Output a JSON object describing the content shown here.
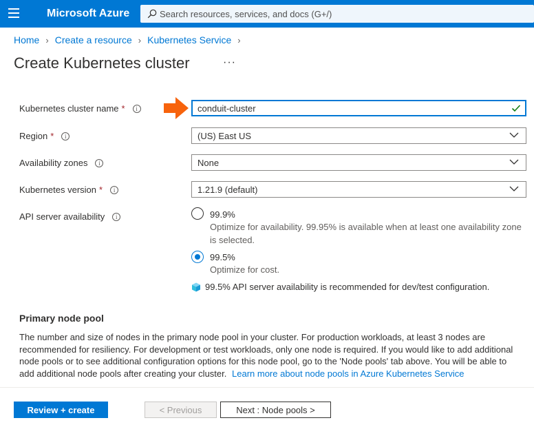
{
  "topbar": {
    "brand": "Microsoft Azure",
    "search_placeholder": "Search resources, services, and docs (G+/)"
  },
  "breadcrumb": [
    "Home",
    "Create a resource",
    "Kubernetes Service"
  ],
  "page_title": "Create Kubernetes cluster",
  "more_label": "···",
  "form": {
    "cluster_name": {
      "label": "Kubernetes cluster name",
      "required": "*",
      "value": "conduit-cluster"
    },
    "region": {
      "label": "Region",
      "required": "*",
      "value": "(US) East US"
    },
    "availability_zones": {
      "label": "Availability zones",
      "value": "None"
    },
    "kubernetes_version": {
      "label": "Kubernetes version",
      "required": "*",
      "value": "1.21.9 (default)"
    },
    "api_server": {
      "label": "API server availability",
      "options": [
        {
          "label": "99.9%",
          "description": "Optimize for availability. 99.95% is available when at least one availability zone is selected.",
          "selected": false
        },
        {
          "label": "99.5%",
          "description": "Optimize for cost.",
          "selected": true
        }
      ],
      "note": "99.5% API server availability is recommended for dev/test configuration."
    }
  },
  "node_pool": {
    "title": "Primary node pool",
    "text": "The number and size of nodes in the primary node pool in your cluster. For production workloads, at least 3 nodes are recommended for resiliency. For development or test workloads, only one node is required. If you would like to add additional node pools or to see additional configuration options for this node pool, go to the 'Node pools' tab above. You will be able to add additional node pools after creating your cluster.",
    "link": "Learn more about node pools in Azure Kubernetes Service"
  },
  "footer": {
    "review_create": "Review + create",
    "previous": "< Previous",
    "next": "Next : Node pools >"
  },
  "colors": {
    "accent": "#0078d4",
    "arrow": "#f7630c",
    "required": "#a4262c",
    "success": "#107c10"
  },
  "icons": [
    "hamburger-icon",
    "search-icon",
    "chevron-right-icon",
    "info-icon",
    "chevron-down-icon",
    "checkmark-icon",
    "arrow-icon",
    "cube-icon"
  ]
}
